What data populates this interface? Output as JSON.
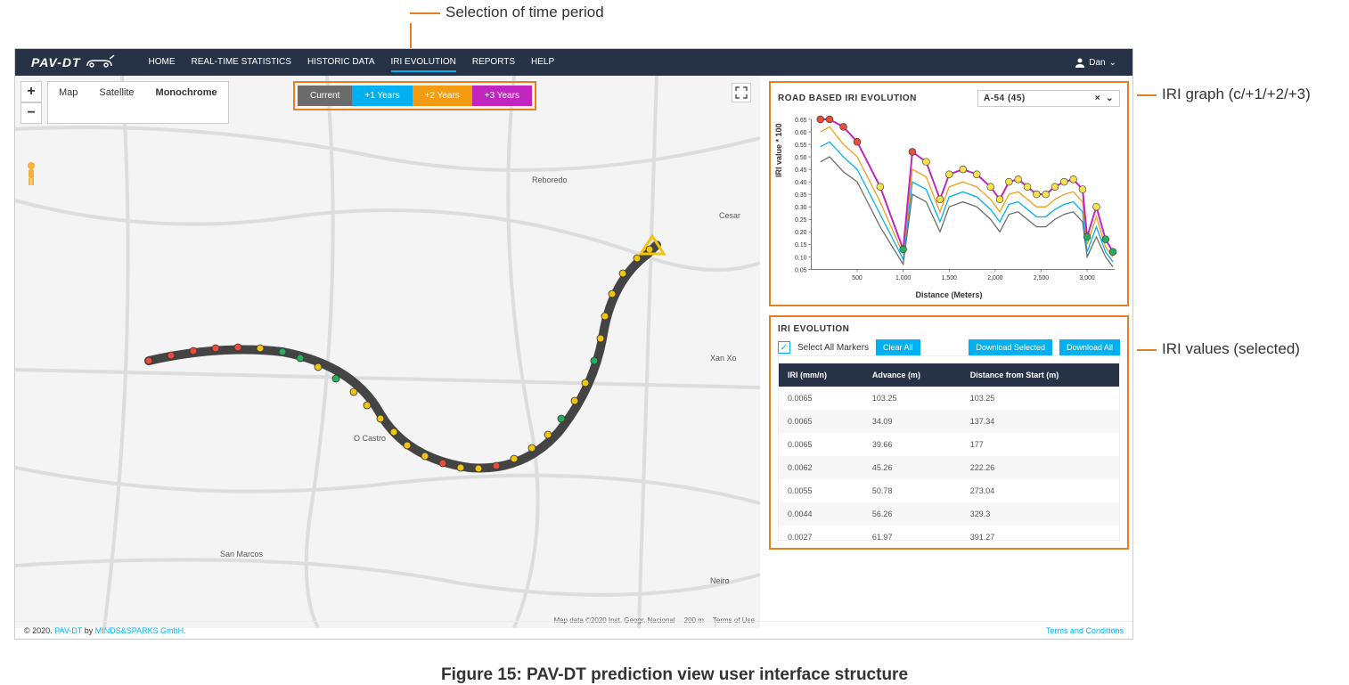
{
  "annotations": {
    "timesel": "Selection of time period",
    "graph": "IRI graph (c/+1/+2/+3)",
    "values": "IRI values (selected)"
  },
  "caption": "Figure 15: PAV-DT prediction view user interface structure",
  "nav": {
    "brand": "PAV-DT",
    "items": [
      "HOME",
      "REAL-TIME STATISTICS",
      "HISTORIC DATA",
      "IRI EVOLUTION",
      "REPORTS",
      "HELP"
    ],
    "active": 3,
    "user": "Dan"
  },
  "map": {
    "tabs": [
      "Map",
      "Satellite",
      "Monochrome"
    ],
    "active_tab": 2,
    "zoom_in": "+",
    "zoom_out": "−",
    "attrib": "Map data ©2020 Inst. Geogr. Nacional",
    "scale": "200 m",
    "terms": "Terms of Use",
    "places": [
      "Reboredo",
      "O Castro",
      "San Marcos",
      "Neiro",
      "Xan Xo",
      "Cesar"
    ]
  },
  "timesel": {
    "current": "Current",
    "y1": "+1 Years",
    "y2": "+2 Years",
    "y3": "+3 Years"
  },
  "chart_panel": {
    "title": "ROAD BASED IRI EVOLUTION",
    "road": "A-54 (45)",
    "ylabel": "IRI value * 100",
    "xlabel": "Distance (Meters)"
  },
  "chart_data": {
    "type": "line",
    "xlabel": "Distance (Meters)",
    "ylabel": "IRI value * 100",
    "xlim": [
      0,
      3300
    ],
    "ylim": [
      0.05,
      0.65
    ],
    "xticks": [
      500,
      1000,
      1500,
      2000,
      2500,
      3000
    ],
    "yticks": [
      0.05,
      0.1,
      0.15,
      0.2,
      0.25,
      0.3,
      0.35,
      0.4,
      0.45,
      0.5,
      0.55,
      0.6,
      0.65
    ],
    "series": [
      {
        "name": "Current",
        "color": "#6b6b6b",
        "values": [
          0.48,
          0.5,
          0.44,
          0.4,
          0.22,
          0.07,
          0.35,
          0.32,
          0.2,
          0.3,
          0.32,
          0.3,
          0.25,
          0.2,
          0.27,
          0.28,
          0.25,
          0.22,
          0.22,
          0.25,
          0.27,
          0.28,
          0.24,
          0.1,
          0.18,
          0.1,
          0.06
        ]
      },
      {
        "name": "+1 Years",
        "color": "#00b0f0",
        "values": [
          0.54,
          0.56,
          0.5,
          0.45,
          0.27,
          0.09,
          0.4,
          0.37,
          0.24,
          0.34,
          0.36,
          0.34,
          0.29,
          0.24,
          0.31,
          0.32,
          0.29,
          0.26,
          0.26,
          0.29,
          0.31,
          0.32,
          0.28,
          0.12,
          0.22,
          0.12,
          0.08
        ]
      },
      {
        "name": "+2 Years",
        "color": "#f39c12",
        "values": [
          0.6,
          0.62,
          0.55,
          0.5,
          0.32,
          0.11,
          0.45,
          0.42,
          0.28,
          0.38,
          0.4,
          0.38,
          0.33,
          0.28,
          0.35,
          0.36,
          0.33,
          0.3,
          0.3,
          0.33,
          0.35,
          0.36,
          0.32,
          0.15,
          0.26,
          0.14,
          0.1
        ]
      },
      {
        "name": "+3 Years",
        "color": "#c025c0",
        "values": [
          0.65,
          0.65,
          0.62,
          0.56,
          0.38,
          0.13,
          0.52,
          0.48,
          0.33,
          0.43,
          0.45,
          0.43,
          0.38,
          0.33,
          0.4,
          0.41,
          0.38,
          0.35,
          0.35,
          0.38,
          0.4,
          0.41,
          0.37,
          0.18,
          0.3,
          0.17,
          0.12
        ]
      }
    ],
    "x": [
      100,
      200,
      350,
      500,
      750,
      1000,
      1100,
      1250,
      1400,
      1500,
      1650,
      1800,
      1950,
      2050,
      2150,
      2250,
      2350,
      2450,
      2550,
      2650,
      2750,
      2850,
      2950,
      3000,
      3100,
      3200,
      3280
    ],
    "point_colors_y3": [
      "red",
      "red",
      "red",
      "red",
      "yellow",
      "green",
      "red",
      "yellow",
      "yellow",
      "yellow",
      "yellow",
      "yellow",
      "yellow",
      "yellow",
      "yellow",
      "yellow",
      "yellow",
      "yellow",
      "yellow",
      "yellow",
      "yellow",
      "yellow",
      "yellow",
      "green",
      "yellow",
      "green",
      "green"
    ]
  },
  "values_panel": {
    "title": "IRI EVOLUTION",
    "select_all": "Select All Markers",
    "clear": "Clear All",
    "dl_sel": "Download Selected",
    "dl_all": "Download All",
    "columns": [
      "IRI (mm/n)",
      "Advance (m)",
      "Distance from Start (m)"
    ],
    "rows": [
      [
        "0.0065",
        "103.25",
        "103.25"
      ],
      [
        "0.0065",
        "34.09",
        "137.34"
      ],
      [
        "0.0065",
        "39.66",
        "177"
      ],
      [
        "0.0062",
        "45.26",
        "222.26"
      ],
      [
        "0.0055",
        "50.78",
        "273.04"
      ],
      [
        "0.0044",
        "56.26",
        "329.3"
      ],
      [
        "0.0027",
        "61.97",
        "391.27"
      ]
    ]
  },
  "footer": {
    "copy": "© 2020.",
    "brand": "PAV-DT",
    "by": "by",
    "company": "MINDS&SPARKS GmbH.",
    "terms": "Terms and Conditions"
  }
}
